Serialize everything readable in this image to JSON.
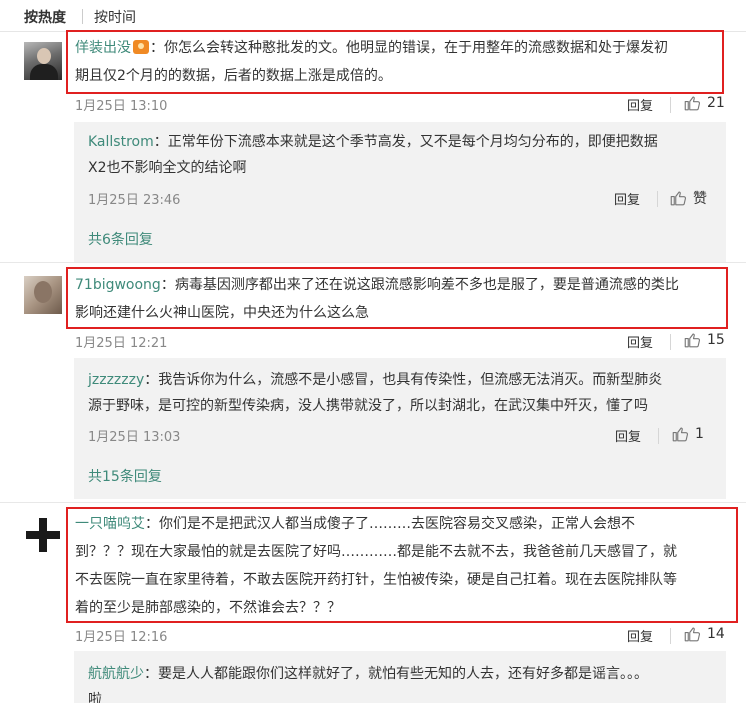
{
  "sort": {
    "hot": "按热度",
    "time": "按时间"
  },
  "comments": [
    {
      "user": "佯装出没",
      "text_line1": "：你怎么会转这种憨批发的文。他明显的错误，在于用整年的流感数据和处于爆发初",
      "text_line2": "期且仅2个月的的数据，后者的数据上涨是成倍的。",
      "time": "1月25日 13:10",
      "reply_label": "回复",
      "likes": "21",
      "sub": {
        "user": "Kallstrom",
        "text_line1": "：正常年份下流感本来就是这个季节高发，又不是每个月均匀分布的，即便把数据",
        "text_line2": "X2也不影响全文的结论啊",
        "time": "1月25日 23:46",
        "reply_label": "回复",
        "likes": "赞"
      },
      "more": "共6条回复"
    },
    {
      "user": "71bigwoong",
      "text_line1": "：病毒基因测序都出来了还在说这跟流感影响差不多也是服了，要是普通流感的类比",
      "text_line2": "影响还建什么火神山医院，中央还为什么这么急",
      "time": "1月25日 12:21",
      "reply_label": "回复",
      "likes": "15",
      "sub": {
        "user": "jzzzzzzy",
        "text_line1": "：我告诉你为什么，流感不是小感冒，也具有传染性，但流感无法消灭。而新型肺炎",
        "text_line2": "源于野味，是可控的新型传染病，没人携带就没了，所以封湖北，在武汉集中歼灭，懂了吗",
        "time": "1月25日 13:03",
        "reply_label": "回复",
        "likes": "1"
      },
      "more": "共15条回复"
    },
    {
      "user": "一只喵呜艾",
      "text_line1": "：你们是不是把武汉人都当成傻子了………去医院容易交叉感染，正常人会想不",
      "text_line2": "到？？？现在大家最怕的就是去医院了好吗…………都是能不去就不去，我爸爸前几天感冒了，就",
      "text_line3": "不去医院一直在家里待着，不敢去医院开药打针，生怕被传染，硬是自己扛着。现在去医院排队等",
      "text_line4": "着的至少是肺部感染的，不然谁会去？？？",
      "time": "1月25日 12:16",
      "reply_label": "回复",
      "likes": "14",
      "sub": {
        "user": "航航航少",
        "text_line1": "：要是人人都能跟你们这样就好了，就怕有些无知的人去，还有好多都是谣言。。。",
        "text_line2": "啦"
      }
    }
  ],
  "colors": {
    "highlight_border": "#e02020",
    "username": "#3f8a7a",
    "reply_bg": "#f2f2f2"
  },
  "icons": {
    "like": "thumbs-up-icon",
    "badge": "vip-badge-icon"
  }
}
